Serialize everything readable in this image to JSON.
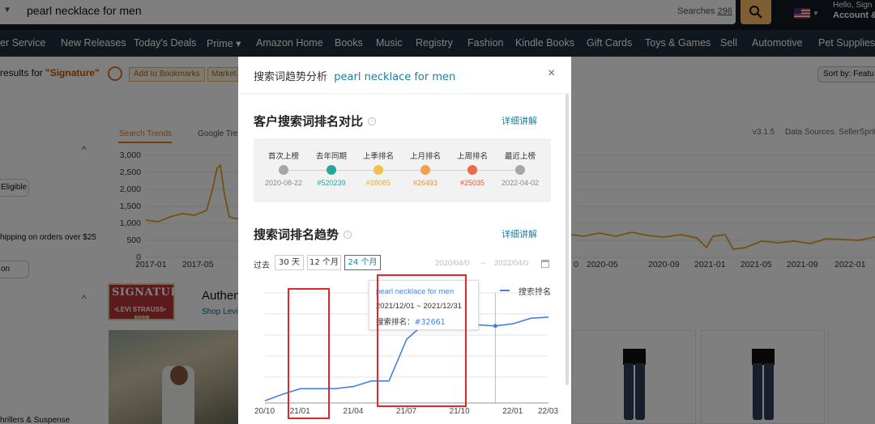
{
  "search": {
    "query": "pearl necklace for men",
    "searches_label": "Searches",
    "searches_count": "296"
  },
  "account": {
    "hello": "Hello, Sign",
    "account_label": "Account &"
  },
  "nav": {
    "items": [
      "er Service",
      "New Releases",
      "Today's Deals",
      "Prime ▾",
      "Amazon Home",
      "Books",
      "Music",
      "Registry",
      "Fashion",
      "Kindle Books",
      "Gift Cards",
      "Toys & Games",
      "Sell",
      "Automotive",
      "Pet Supplies"
    ]
  },
  "results": {
    "prefix": "results for ",
    "query": "\"Signature\"",
    "bookmark_btn": "Add to Bookmarks",
    "market_btn": "Market",
    "sort_label": "Sort by:  Featu"
  },
  "filters": {
    "eligible": "Eligible",
    "shipping": "hipping on orders over $25",
    "on": "on",
    "thrillers": "hrillers & Suspense"
  },
  "trends_panel": {
    "tab_search": "Search Trends",
    "tab_google": "Google Tre",
    "version": "v3.1.5",
    "data_sources": "Data Sources: SellerSprit",
    "y_ticks": [
      "3,000",
      "2,500",
      "2,000",
      "1,500",
      "1,000",
      "500",
      "0"
    ],
    "x_ticks": [
      "2017-01",
      "2017-05",
      "2020-05",
      "2020-09",
      "2021-01",
      "2021-05",
      "2021-09",
      "2022-01"
    ],
    "x_ticks_left_partial": [
      "0"
    ]
  },
  "brand": {
    "logo_top": "SIGNATURE",
    "logo_bottom": "•LEVI STRAUSS•",
    "logo_sold": "SOLD",
    "headline": "Authen",
    "shop_link": "Shop Levi"
  },
  "modal": {
    "title": "搜索词趋势分析",
    "keyword": "pearl necklace for men",
    "close": "×",
    "section1_title": "客户搜索词排名对比",
    "section1_link": "详细讲解",
    "rank_items": [
      {
        "label": "首次上榜",
        "value": "2020-08-22",
        "color": "#a6a6a6",
        "value_color": "#888888"
      },
      {
        "label": "去年同期",
        "value": "#520239",
        "color": "#26a69a",
        "value_color": "#26a69a"
      },
      {
        "label": "上季排名",
        "value": "#28085",
        "color": "#f2c04d",
        "value_color": "#e6b030"
      },
      {
        "label": "上月排名",
        "value": "#26493",
        "color": "#f0a050",
        "value_color": "#ee8e3a"
      },
      {
        "label": "上周排名",
        "value": "#25035",
        "color": "#ee6a4a",
        "value_color": "#e8542f"
      },
      {
        "label": "最近上榜",
        "value": "2022-04-02",
        "color": "#a6a6a6",
        "value_color": "#888888"
      }
    ],
    "section2_title": "搜索词排名趋势",
    "section2_link": "详细讲解",
    "range_prefix": "过去",
    "range_buttons": [
      "30 天",
      "12 个月",
      "24 个月"
    ],
    "range_active": "24 个月",
    "date_from": "2020/04/0",
    "date_arrow": "→",
    "date_to": "2022/04/0",
    "legend": "搜索排名",
    "x_ticks": [
      "20/10",
      "21/01",
      "21/04",
      "21/07",
      "21/10",
      "22/01",
      "22/03"
    ],
    "tooltip": {
      "keyword": "pearl necklace for men",
      "range": "2021/12/01 ~ 2021/12/31",
      "rank_label": "搜索排名：",
      "rank_value": "#32661"
    }
  },
  "chart_data": {
    "type": "line",
    "title": "",
    "xlabel": "",
    "ylabel": "",
    "x": [
      "20/10",
      "20/12",
      "21/01",
      "21/02",
      "21/03",
      "21/04",
      "21/05",
      "21/06",
      "21/07",
      "21/08",
      "21/09",
      "21/10",
      "21/11",
      "21/12",
      "22/01",
      "22/02",
      "22/03"
    ],
    "series": [
      {
        "name": "搜索排名",
        "values": [
          0.02,
          0.08,
          0.13,
          0.13,
          0.13,
          0.15,
          0.2,
          0.2,
          0.58,
          0.72,
          0.72,
          0.7,
          0.71,
          0.7,
          0.72,
          0.77,
          0.78
        ]
      }
    ],
    "x_ticks": [
      "20/10",
      "21/01",
      "21/04",
      "21/07",
      "21/10",
      "22/01",
      "22/03"
    ],
    "grid": true,
    "legend_position": "top-right",
    "colors": {
      "line": "#4a7fe2",
      "highlight": "#e5242b"
    }
  }
}
